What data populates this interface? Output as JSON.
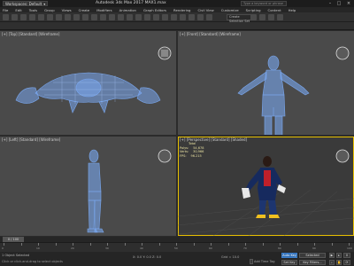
{
  "titlebar": {
    "workspace": "Workspaces: Default",
    "title": "Autodesk 3ds Max 2017    MAX1.max",
    "search_placeholder": "Type a keyword or phrase"
  },
  "menu": [
    "File",
    "Edit",
    "Tools",
    "Group",
    "Views",
    "Create",
    "Modifiers",
    "Animation",
    "Graph Editors",
    "Rendering",
    "Civil View",
    "Customize",
    "Scripting",
    "Content",
    "Help"
  ],
  "toolbar": {
    "selection_set": "Create Selection Set"
  },
  "viewports": {
    "top": {
      "label": "[+] [Top] [Standard] [Wireframe]"
    },
    "front": {
      "label": "[+] [Front] [Standard] [Wireframe]"
    },
    "left": {
      "label": "[+] [Left] [Standard] [Wireframe]"
    },
    "perspective": {
      "label": "[+] [Perspective] [Standard] [Shaded]",
      "stats_total": "Total",
      "stats": [
        {
          "key": "Polys:",
          "value": "54,678"
        },
        {
          "key": "Verts:",
          "value": "30,966"
        },
        {
          "key": "FPS:",
          "value": "96.215"
        }
      ]
    }
  },
  "timeline": {
    "slider": "0 / 100",
    "ticks": [
      "0",
      "10",
      "20",
      "30",
      "40",
      "50",
      "60",
      "70",
      "80",
      "90",
      "100"
    ]
  },
  "status": {
    "selection": "1 Object Selected",
    "prompt": "Click or click-and-drag to select objects",
    "coords": "X: 0.0   Y: 0.0   Z: 0.0",
    "grid": "Grid = 10.0",
    "auto_key": "Auto Key",
    "set_key": "Set Key",
    "selected": "Selected",
    "key_filters": "Key Filters...",
    "add_time_tag": "Add Time Tag"
  },
  "colors": {
    "wire_blue": "#7aa8f0",
    "accent_yellow": "#e8c000",
    "viewport_bg": "#4a4a4a"
  }
}
